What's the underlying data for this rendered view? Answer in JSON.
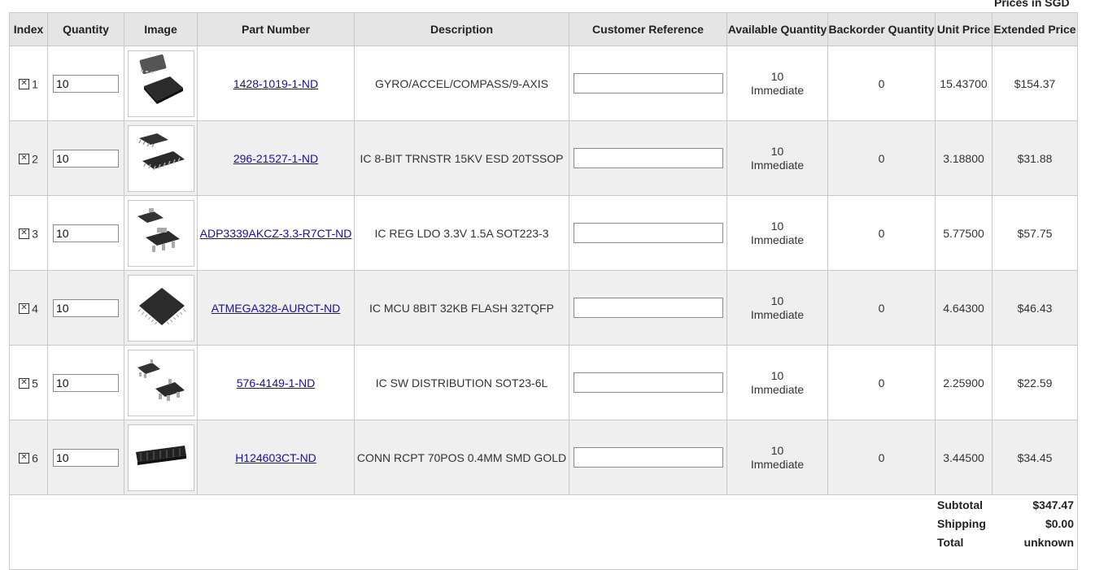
{
  "prices_note": "Prices in SGD",
  "headers": {
    "index": "Index",
    "quantity": "Quantity",
    "image": "Image",
    "part_number": "Part Number",
    "description": "Description",
    "customer_reference": "Customer Reference",
    "available_quantity": "Available Quantity",
    "backorder_quantity": "Backorder Quantity",
    "unit_price": "Unit Price",
    "extended_price": "Extended Price"
  },
  "rows": [
    {
      "index": "1",
      "quantity": "10",
      "part": "1428-1019-1-ND",
      "description": "GYRO/ACCEL/COMPASS/9-AXIS",
      "available_qty": "10",
      "available_status": "Immediate",
      "backorder": "0",
      "unit_price": "15.43700",
      "extended": "$154.37",
      "image_icon": "qfn-chip-icon"
    },
    {
      "index": "2",
      "quantity": "10",
      "part": "296-21527-1-ND",
      "description": "IC 8-BIT TRNSTR 15KV ESD 20TSSOP",
      "available_qty": "10",
      "available_status": "Immediate",
      "backorder": "0",
      "unit_price": "3.18800",
      "extended": "$31.88",
      "image_icon": "tssop-chip-icon"
    },
    {
      "index": "3",
      "quantity": "10",
      "part": "ADP3339AKCZ-3.3-R7CT-ND",
      "description": "IC REG LDO 3.3V 1.5A SOT223-3",
      "available_qty": "10",
      "available_status": "Immediate",
      "backorder": "0",
      "unit_price": "5.77500",
      "extended": "$57.75",
      "image_icon": "sot223-chip-icon"
    },
    {
      "index": "4",
      "quantity": "10",
      "part": "ATMEGA328-AURCT-ND",
      "description": "IC MCU 8BIT 32KB FLASH 32TQFP",
      "available_qty": "10",
      "available_status": "Immediate",
      "backorder": "0",
      "unit_price": "4.64300",
      "extended": "$46.43",
      "image_icon": "tqfp-chip-icon"
    },
    {
      "index": "5",
      "quantity": "10",
      "part": "576-4149-1-ND",
      "description": "IC SW DISTRIBUTION SOT23-6L",
      "available_qty": "10",
      "available_status": "Immediate",
      "backorder": "0",
      "unit_price": "2.25900",
      "extended": "$22.59",
      "image_icon": "sot23-chip-icon"
    },
    {
      "index": "6",
      "quantity": "10",
      "part": "H124603CT-ND",
      "description": "CONN RCPT 70POS 0.4MM SMD GOLD",
      "available_qty": "10",
      "available_status": "Immediate",
      "backorder": "0",
      "unit_price": "3.44500",
      "extended": "$34.45",
      "image_icon": "connector-icon"
    }
  ],
  "totals": {
    "subtotal_label": "Subtotal",
    "subtotal": "$347.47",
    "shipping_label": "Shipping",
    "shipping": "$0.00",
    "total_label": "Total",
    "total": "unknown"
  },
  "colors": {
    "link": "#1a0dab",
    "header_bg": "#e5e5e5",
    "alt_row_bg": "#efefef",
    "border": "#c8c8c8"
  }
}
